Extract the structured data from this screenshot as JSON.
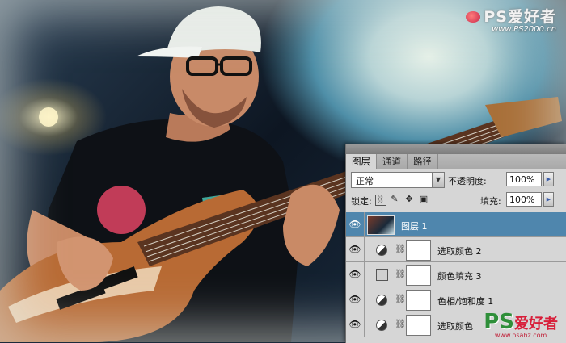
{
  "watermark_top": {
    "brand": "PS爱好者",
    "url": "www.PS2000.cn"
  },
  "watermark_bottom": {
    "ps": "PS",
    "cn": "爱好者",
    "url": "www.psahz.com"
  },
  "panel": {
    "tabs": [
      {
        "label": "图层",
        "active": true
      },
      {
        "label": "通道",
        "active": false
      },
      {
        "label": "路径",
        "active": false
      }
    ],
    "blend_mode": "正常",
    "opacity_label": "不透明度:",
    "opacity_value": "100%",
    "lock_label": "锁定:",
    "fill_label": "填充:",
    "fill_value": "100%",
    "layers": [
      {
        "name": "图层 1",
        "type": "pixel",
        "selected": true
      },
      {
        "name": "选取颜色 2",
        "type": "adjustment",
        "selected": false
      },
      {
        "name": "颜色填充 3",
        "type": "fill",
        "selected": false
      },
      {
        "name": "色相/饱和度 1",
        "type": "adjustment",
        "selected": false
      },
      {
        "name": "选取颜色",
        "type": "adjustment",
        "selected": false
      }
    ]
  },
  "colors": {
    "selected_layer": "#4f86ad",
    "panel_bg": "#d6d6d6",
    "accent_arrow": "#3a5ca8"
  }
}
